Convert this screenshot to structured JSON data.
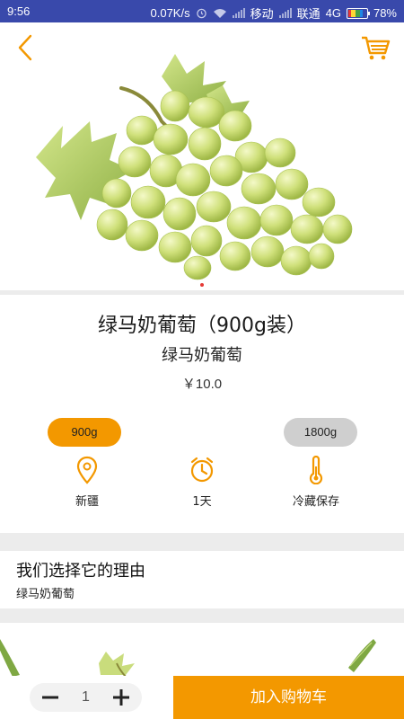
{
  "status_bar": {
    "time": "9:56",
    "speed": "0.07K/s",
    "carrier1": "移动",
    "carrier2": "联通",
    "network": "4G",
    "battery": "78%"
  },
  "header": {
    "back_icon": "chevron-left-icon",
    "cart_icon": "shopping-cart-icon",
    "accent_color": "#f39800"
  },
  "carousel": {
    "page_count": 1,
    "active_index": 0,
    "indicator_color": "#e53935"
  },
  "product": {
    "title": "绿马奶葡萄（900g装）",
    "subtitle": "绿马奶葡萄",
    "price": "￥10.0"
  },
  "specs": [
    {
      "label": "900g",
      "selected": true
    },
    {
      "label": "1800g",
      "selected": false
    }
  ],
  "attributes": [
    {
      "icon": "location-pin-icon",
      "label": "新疆"
    },
    {
      "icon": "alarm-clock-icon",
      "label": "1天"
    },
    {
      "icon": "thermometer-icon",
      "label": "冷藏保存"
    }
  ],
  "reason": {
    "title": "我们选择它的理由",
    "text": "绿马奶葡萄"
  },
  "bottom_bar": {
    "quantity": "1",
    "minus_icon": "minus-icon",
    "plus_icon": "plus-icon",
    "add_to_cart_label": "加入购物车",
    "add_to_cart_color": "#f39800"
  }
}
